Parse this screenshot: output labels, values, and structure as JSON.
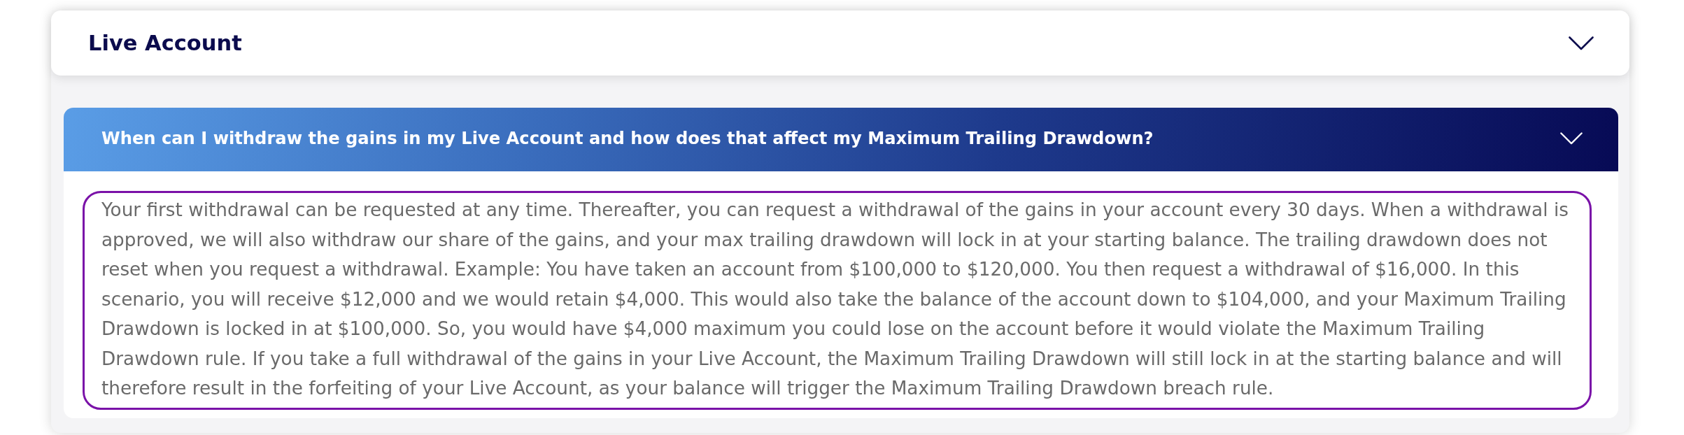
{
  "section": {
    "title": "Live Account",
    "expanded": true
  },
  "faq_items": [
    {
      "question": "When can I withdraw the gains in my Live Account and how does that affect my Maximum Trailing Drawdown?",
      "expanded": true,
      "answer": "Your first withdrawal can be requested at any time. Thereafter, you can request a withdrawal of the gains in your account every 30 days. When a withdrawal is approved, we will also withdraw our share of the gains, and your max trailing drawdown will lock in at your starting balance. The trailing drawdown does not reset when you request a withdrawal. Example: You have taken an account from $100,000 to $120,000. You then request a withdrawal of $16,000. In this scenario, you will receive $12,000 and we would retain $4,000. This would also take the balance of the account down to $104,000, and your Maximum Trailing Drawdown is locked in at $100,000. So, you would have $4,000 maximum you could lose on the account before it would violate the Maximum Trailing Drawdown rule. If you take a full withdrawal of the gains in your Live Account, the Maximum Trailing Drawdown will still lock in at the starting balance and will therefore result in the forfeiting of your Live Account, as your balance will trigger the Maximum Trailing Drawdown breach rule."
    }
  ]
}
